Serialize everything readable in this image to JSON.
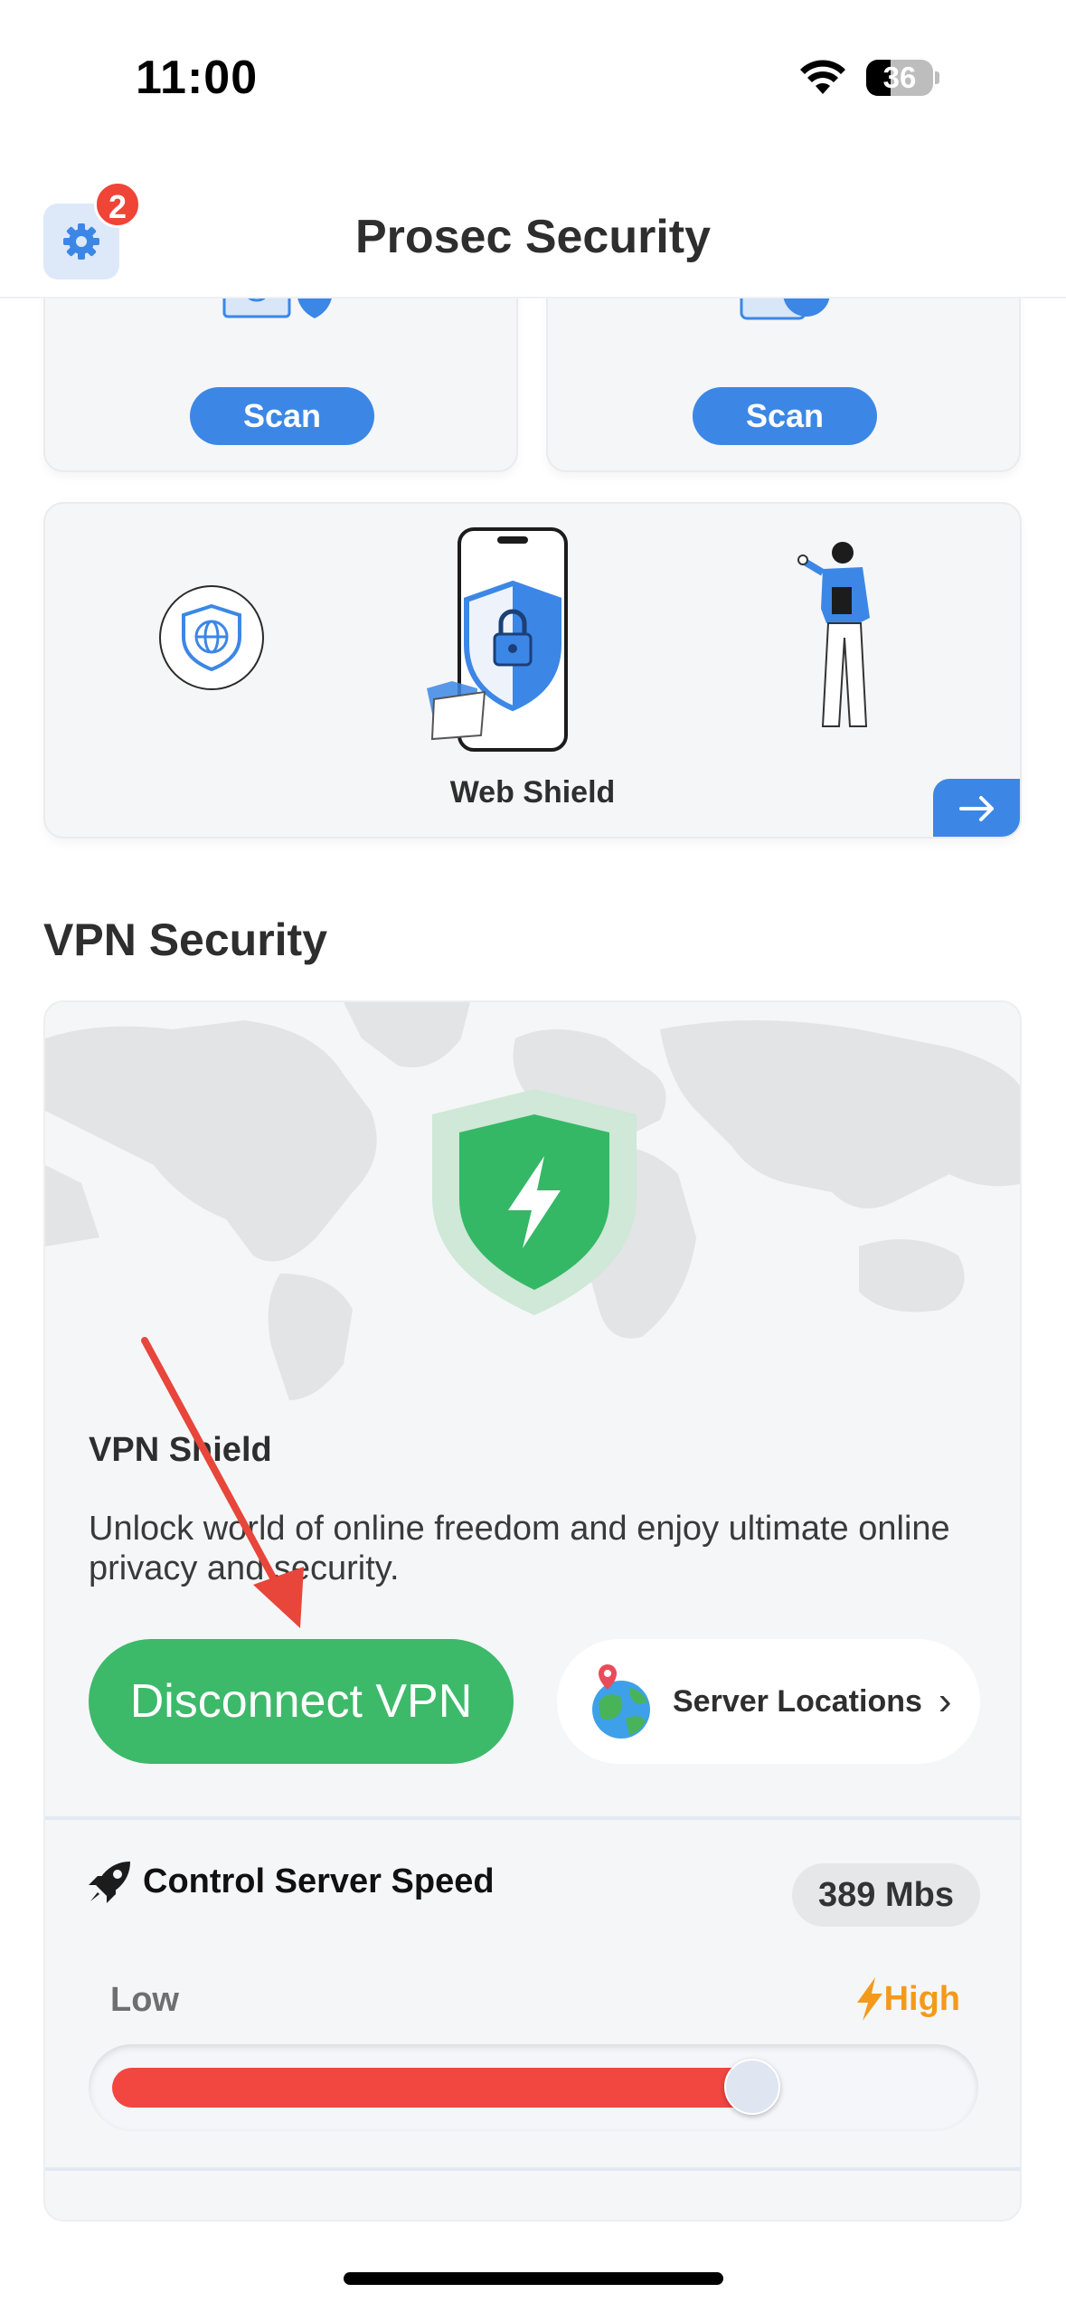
{
  "status_bar": {
    "time": "11:00",
    "battery_level": "36",
    "battery_fraction": 0.36
  },
  "header": {
    "title": "Prosec Security",
    "notification_count": "2",
    "settings_icon": "gear-icon"
  },
  "scan_cards": [
    {
      "button_label": "Scan",
      "icon": "device-shield-icon"
    },
    {
      "button_label": "Scan",
      "icon": "clock-device-icon"
    }
  ],
  "web_shield": {
    "title": "Web Shield",
    "icons": [
      "globe-shield-icon",
      "phone-lock-icon",
      "person-illustration",
      "arrow-right-icon"
    ]
  },
  "vpn": {
    "section_title": "VPN Security",
    "shield_name": "VPN Shield",
    "description": "Unlock world of online freedom and enjoy ultimate online privacy and security.",
    "disconnect_label": "Disconnect VPN",
    "server_locations_label": "Server Locations",
    "speed_title": "Control Server Speed",
    "speed_value": "389 Mbs",
    "low_label": "Low",
    "high_label": "High",
    "speed_level": 0.76,
    "colors": {
      "connected_green": "#3cba6a",
      "slider_red": "#f24640",
      "high_orange": "#f39a1b",
      "accent_blue": "#3c87e6"
    }
  }
}
